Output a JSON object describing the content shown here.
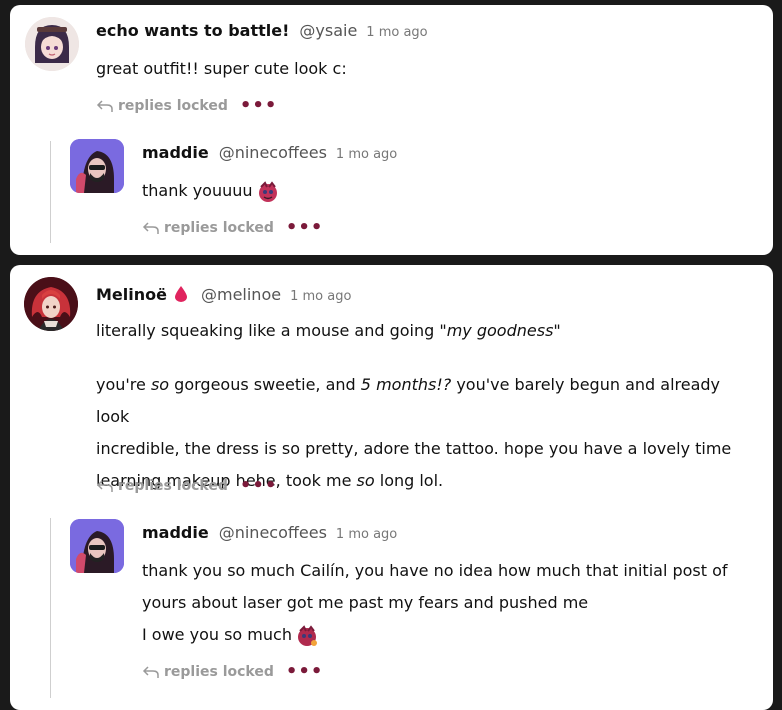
{
  "threads": [
    {
      "comment": {
        "display_name": "echo wants to battle!",
        "handle": "@ysaie",
        "time": "1 mo ago",
        "text": "great outfit!! super cute look c:",
        "replies_label": "replies locked",
        "avatar": "avatar-echo"
      },
      "reply": {
        "display_name": "maddie",
        "handle": "@ninecoffees",
        "time": "1 mo ago",
        "text": "thank youuuu",
        "emoji": "emoji-sticker-icon",
        "replies_label": "replies locked",
        "avatar": "avatar-maddie"
      }
    },
    {
      "comment": {
        "display_name": "Melinoë",
        "badge": "blood-drop-icon",
        "handle": "@melinoe",
        "time": "1 mo ago",
        "p1_a": "literally squeaking like a mouse and going \"",
        "p1_italic": "my goodness",
        "p1_b": "\"",
        "p2_a": "you're ",
        "p2_i1": "so",
        "p2_b": " gorgeous sweetie, and ",
        "p2_i2": "5 months!?",
        "p2_c": " you've barely begun and already look",
        "p3": "incredible, the dress is so pretty, adore the tattoo. hope you have a lovely time",
        "p4_a": "learning makeup hehe, took me ",
        "p4_i": "so",
        "p4_b": " long lol.",
        "replies_label": "replies locked",
        "avatar": "avatar-melinoe"
      },
      "reply": {
        "display_name": "maddie",
        "handle": "@ninecoffees",
        "time": "1 mo ago",
        "line1": "thank you so much Cailín, you have no idea how much that initial post of",
        "line2": "yours about laser got me past my fears and pushed me",
        "line3": "I owe you so much",
        "emoji": "emoji-sticker-icon",
        "replies_label": "replies locked",
        "avatar": "avatar-maddie"
      }
    }
  ],
  "colors": {
    "background": "#1a1a1a",
    "card": "#ffffff",
    "accent_dots": "#7b1a3a",
    "muted": "#9a9a9a",
    "drop": "#e0245e"
  }
}
